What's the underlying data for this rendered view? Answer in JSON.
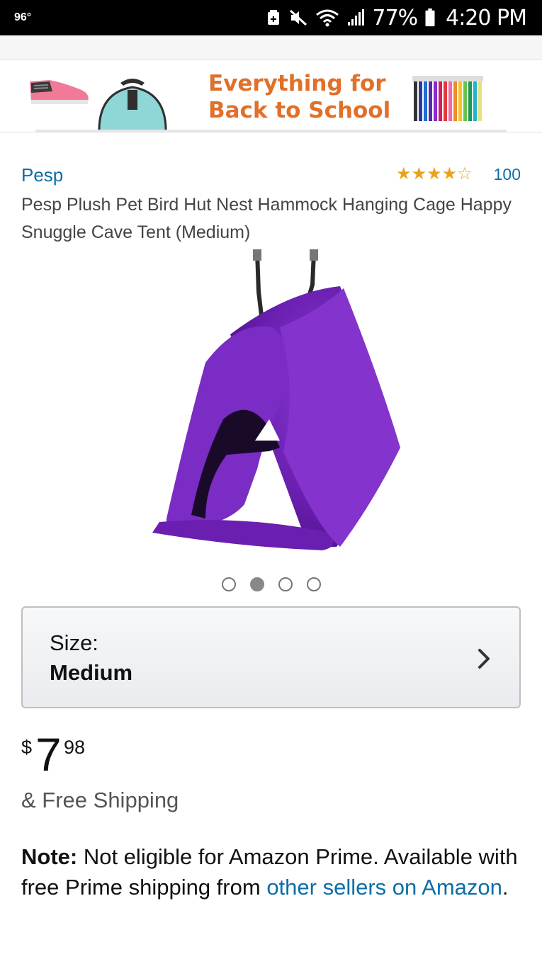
{
  "status_bar": {
    "temperature": "96°",
    "battery_percent": "77%",
    "time": "4:20 PM",
    "icons": [
      "android-icon",
      "mute-icon",
      "wifi-icon",
      "signal-icon",
      "battery-icon"
    ]
  },
  "banner": {
    "line1": "Everything for",
    "line2": "Back to School",
    "accent_color": "#e0702a",
    "images": [
      "shoe-image",
      "backpack-image",
      "pens-image"
    ]
  },
  "product": {
    "brand": "Pesp",
    "rating_stars": 4,
    "rating_max": 5,
    "rating_count": "100",
    "title": "Pesp Plush Pet Bird Hut Nest Hammock Hanging Cage Happy Snuggle Cave Tent (Medium)",
    "image_count": 4,
    "active_image_index": 1,
    "image_color": "#6a1fb0"
  },
  "size_selector": {
    "label": "Size:",
    "value": "Medium"
  },
  "price": {
    "symbol": "$",
    "whole": "7",
    "fraction": "98",
    "shipping": "& Free Shipping"
  },
  "note": {
    "label": "Note:",
    "text_before": " Not eligible for Amazon Prime. Available with free Prime shipping from ",
    "link_text": "other sellers on Amazon",
    "text_after": "."
  },
  "colors": {
    "link": "#0b6ea8",
    "star": "#e9a21a",
    "status_bar_bg": "#000000"
  }
}
